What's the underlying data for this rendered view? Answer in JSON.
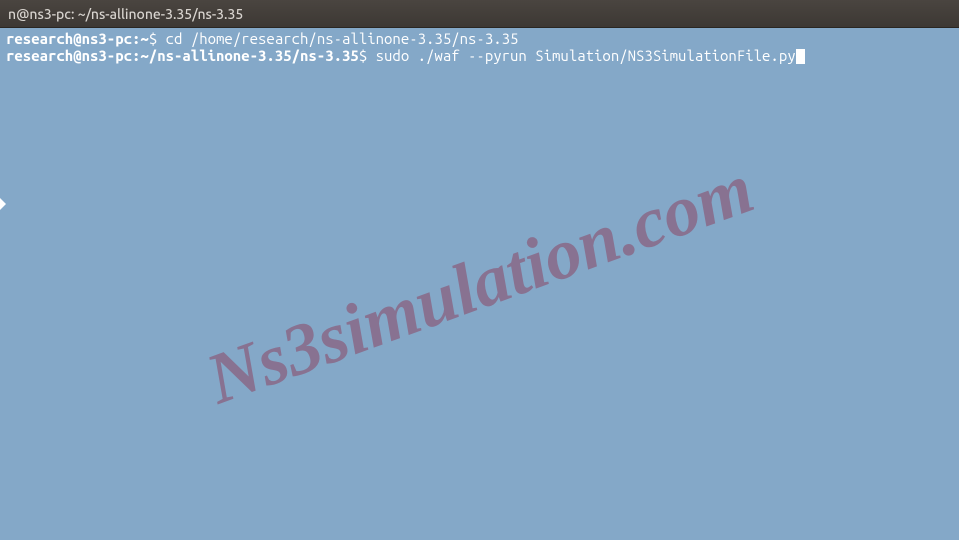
{
  "titlebar": {
    "title": "n@ns3-pc: ~/ns-allinone-3.35/ns-3.35"
  },
  "terminal": {
    "lines": [
      {
        "prompt_user": "research@ns3-pc:",
        "prompt_path": "~",
        "prompt_symbol": "$ ",
        "command": "cd /home/research/ns-allinone-3.35/ns-3.35"
      },
      {
        "prompt_user": "research@ns3-pc:",
        "prompt_path": "~/ns-allinone-3.35/ns-3.35",
        "prompt_symbol": "$ ",
        "command": "sudo ./waf --pyrun Simulation/NS3SimulationFile.py"
      }
    ]
  },
  "watermark": {
    "text": "Ns3simulation.com"
  }
}
